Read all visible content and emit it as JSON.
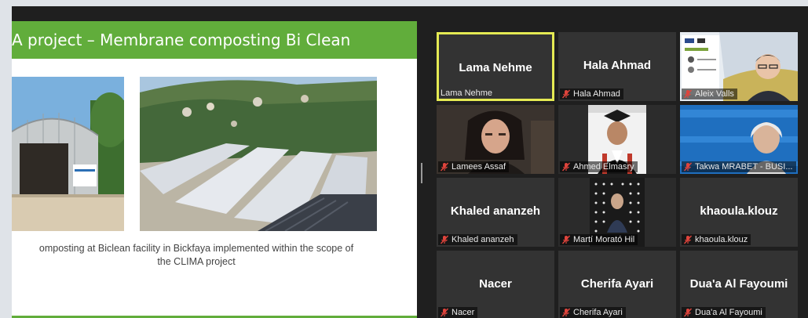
{
  "slide": {
    "title": "A project – Membrane composting Bi Clean",
    "caption_line1": "omposting at Biclean facility in Bickfaya implemented within the scope of",
    "caption_line2": "the CLIMA project"
  },
  "participants": [
    {
      "name": "Lama Nehme",
      "label": "Lama Nehme",
      "muted": false,
      "active": true,
      "video": false
    },
    {
      "name": "Hala Ahmad",
      "label": "Hala Ahmad",
      "muted": true,
      "active": false,
      "video": false
    },
    {
      "name": "Aleix Valls",
      "label": "Aleix Valls",
      "muted": true,
      "active": false,
      "video": true
    },
    {
      "name": "Lamees Assaf",
      "label": "Lamees Assaf",
      "muted": true,
      "active": false,
      "video": true
    },
    {
      "name": "Ahmed Elmasry",
      "label": "Ahmed Elmasry",
      "muted": true,
      "active": false,
      "video": true
    },
    {
      "name": "Takwa MRABET",
      "label": "Takwa MRABET - BUSI...",
      "muted": true,
      "active": false,
      "video": true
    },
    {
      "name": "Khaled ananzeh",
      "label": "Khaled ananzeh",
      "muted": true,
      "active": false,
      "video": false
    },
    {
      "name": "Martí Morató Hil",
      "label": "Martí Morató Hil",
      "muted": true,
      "active": false,
      "video": true
    },
    {
      "name": "khaoula.klouz",
      "label": "khaoula.klouz",
      "muted": true,
      "active": false,
      "video": false
    },
    {
      "name": "Nacer",
      "label": "Nacer",
      "muted": true,
      "active": false,
      "video": false
    },
    {
      "name": "Cherifa Ayari",
      "label": "Cherifa Ayari",
      "muted": true,
      "active": false,
      "video": false
    },
    {
      "name": "Dua'a Al Fayoumi",
      "label": "Dua'a Al Fayoumi",
      "muted": true,
      "active": false,
      "video": false
    }
  ],
  "colors": {
    "accent_green": "#61ad3b",
    "active_speaker_border": "#e5ea53",
    "muted_icon": "#e0443c",
    "tile_bg": "#333333"
  },
  "icons": {
    "muted": "mic-muted-icon"
  }
}
